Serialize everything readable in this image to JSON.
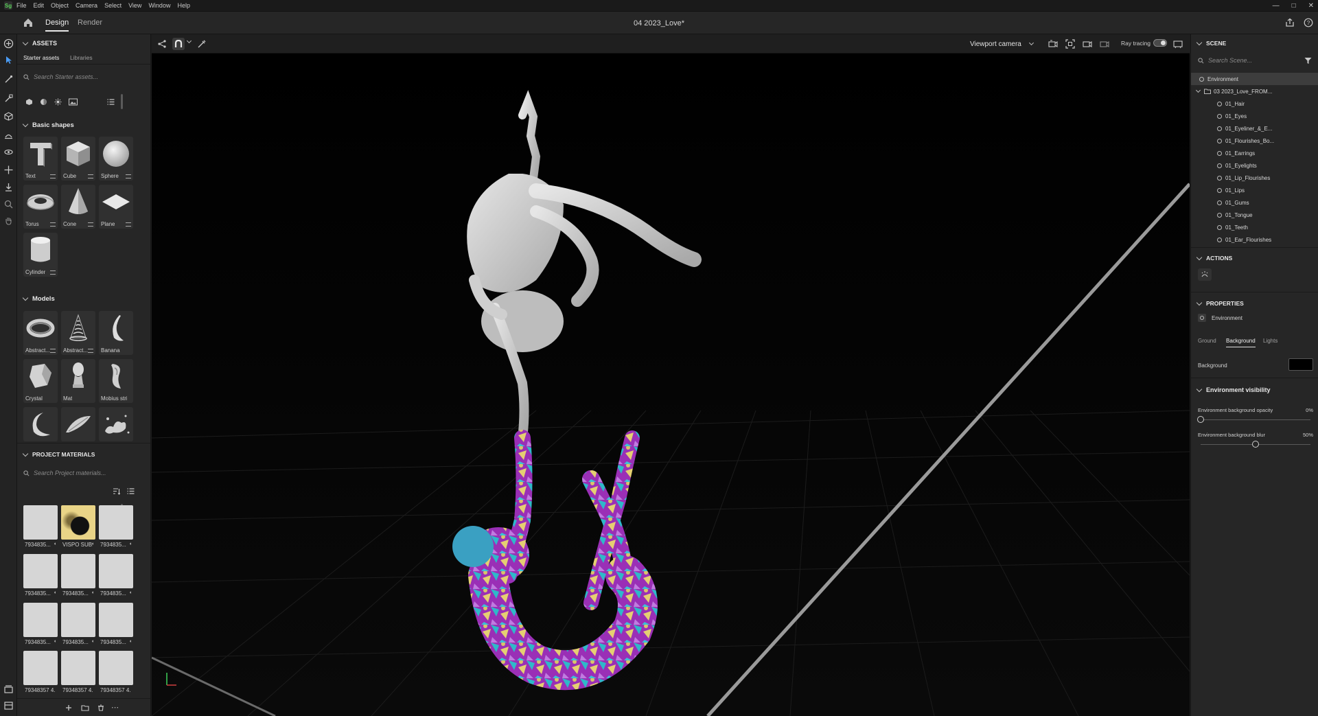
{
  "menubar": {
    "items": [
      "File",
      "Edit",
      "Object",
      "Camera",
      "Select",
      "View",
      "Window",
      "Help"
    ]
  },
  "header": {
    "tabs": [
      "Design",
      "Render"
    ],
    "active_tab": "Design",
    "document_title": "04 2023_Love*"
  },
  "assets": {
    "section_title": "ASSETS",
    "subtabs": [
      "Starter assets",
      "Libraries"
    ],
    "search_placeholder": "Search Starter assets...",
    "basic_shapes_title": "Basic shapes",
    "basic_shapes": [
      "Text",
      "Cube",
      "Sphere",
      "Torus",
      "Cone",
      "Plane",
      "Cylinder"
    ],
    "models_title": "Models",
    "models": [
      "Abstract...",
      "Abstract...",
      "Banana",
      "Crystal",
      "Mat",
      "Mobius strip"
    ]
  },
  "project_materials": {
    "section_title": "PROJECT MATERIALS",
    "search_placeholder": "Search Project materials...",
    "materials": [
      "7934835...",
      "VISPO SUB...",
      "7934835...",
      "7934835...",
      "7934835...",
      "7934835...",
      "7934835...",
      "7934835...",
      "7934835...",
      "79348357 4...",
      "79348357 4...",
      "79348357 4..."
    ]
  },
  "viewport": {
    "camera": "Viewport camera",
    "ray_tracing_label": "Ray tracing",
    "ray_tracing_on": true
  },
  "scene": {
    "section_title": "SCENE",
    "search_placeholder": "Search Scene...",
    "environment": "Environment",
    "group": "03 2023_Love_FROM...",
    "children": [
      "01_Hair",
      "01_Eyes",
      "01_Eyeliner_&_E...",
      "01_Flourishes_Bo...",
      "01_Earrings",
      "01_Eyelights",
      "01_Lip_Flourishes",
      "01_Lips",
      "01_Gums",
      "01_Tongue",
      "01_Teeth",
      "01_Ear_Flourishes"
    ]
  },
  "actions": {
    "section_title": "ACTIONS"
  },
  "properties": {
    "section_title": "PROPERTIES",
    "selected": "Environment",
    "tabs": [
      "Ground",
      "Background",
      "Lights"
    ],
    "active_tab": "Background",
    "background_label": "Background",
    "background_color": "#000000",
    "env_visibility_title": "Environment visibility",
    "opacity_label": "Environment background opacity",
    "opacity_value": "0%",
    "opacity_fraction": 0.0,
    "blur_label": "Environment background blur",
    "blur_value": "50%",
    "blur_fraction": 0.5
  },
  "colors": {
    "accent_blue": "#4b9cf5",
    "panel_bg": "#262626",
    "viewport_bg": "#000000"
  }
}
